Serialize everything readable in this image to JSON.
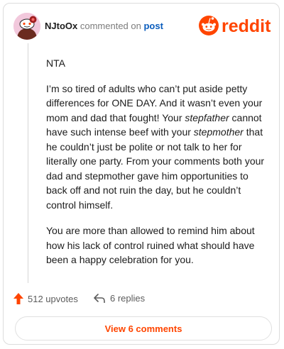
{
  "header": {
    "username": "NJtoOx",
    "action_text": "commented on",
    "link_text": "post",
    "logo_text": "reddit",
    "avatar_icon": "snoo-avatar-icon",
    "brand_color": "#ff4500"
  },
  "comment": {
    "paragraphs": [
      {
        "segments": [
          {
            "text": "NTA"
          }
        ]
      },
      {
        "segments": [
          {
            "text": "I’m so tired of adults who can’t put aside petty differences for ONE DAY. And it wasn’t even your mom and dad that fought! Your "
          },
          {
            "text": "stepfather",
            "italic": true
          },
          {
            "text": " cannot have such intense beef with your "
          },
          {
            "text": "stepmother",
            "italic": true
          },
          {
            "text": " that he couldn’t just be polite or not talk to her for literally one party. From your comments both your dad and stepmother gave him opportunities to back off and not ruin the day, but he couldn’t control himself."
          }
        ]
      },
      {
        "segments": [
          {
            "text": "You are more than allowed to remind him about how his lack of control ruined what should have been a happy celebration for you."
          }
        ]
      }
    ]
  },
  "footer": {
    "upvotes": "512 upvotes",
    "replies": "6 replies",
    "upvote_icon": "upvote-arrow-icon",
    "reply_icon": "reply-arrow-icon"
  },
  "view_button": {
    "label": "View 6 comments"
  }
}
